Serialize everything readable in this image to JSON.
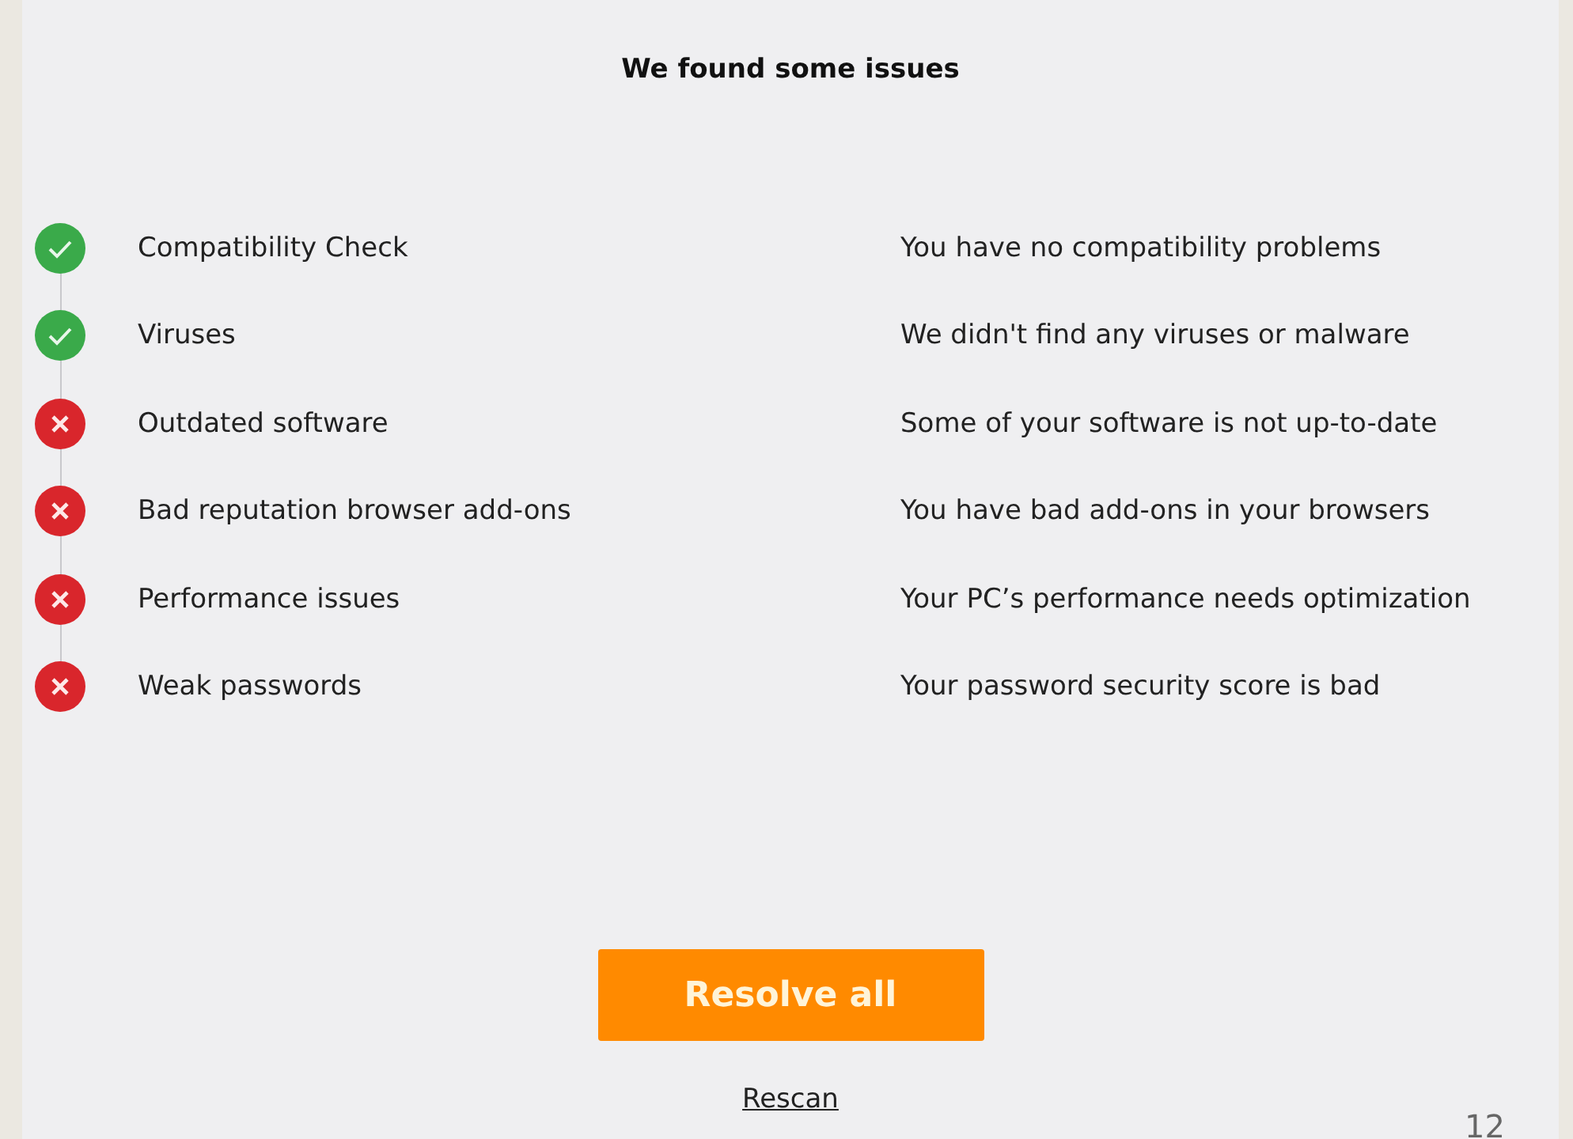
{
  "title": "We found some issues",
  "checks": [
    {
      "name": "Compatibility Check",
      "passed": true,
      "message": "You have no compatibility problems"
    },
    {
      "name": "Viruses",
      "passed": true,
      "message": "We didn't find any viruses or malware"
    },
    {
      "name": "Outdated software",
      "passed": false,
      "message": "Some of your software is not up-to-date"
    },
    {
      "name": "Bad reputation browser add-ons",
      "passed": false,
      "message": "You have bad add-ons in your browsers"
    },
    {
      "name": "Performance issues",
      "passed": false,
      "message": "Your PC’s performance needs optimization"
    },
    {
      "name": "Weak passwords",
      "passed": false,
      "message": "Your password security score is bad"
    }
  ],
  "primary_button": "Resolve all",
  "link": "Rescan",
  "page_number": "12"
}
